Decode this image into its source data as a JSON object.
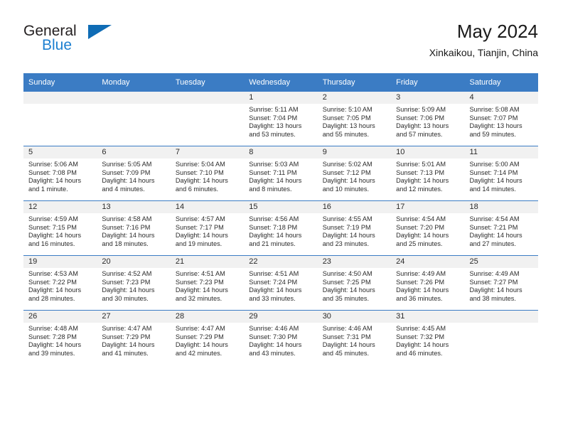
{
  "logo": {
    "word_one": "General",
    "word_two": "Blue",
    "triangle_icon": "triangle-icon",
    "colors": {
      "text": "#231f20",
      "blue": "#1c7fd0",
      "triangle": "#0f6cb5"
    }
  },
  "header": {
    "title": "May 2024",
    "subtitle": "Xinkaikou, Tianjin, China"
  },
  "theme": {
    "header_blue": "#3b7cc4",
    "band_gray": "#f1f1f1",
    "text": "#2b2b2b"
  },
  "weekday_headers": [
    "Sunday",
    "Monday",
    "Tuesday",
    "Wednesday",
    "Thursday",
    "Friday",
    "Saturday"
  ],
  "weeks": [
    [
      {
        "day": "",
        "sunrise": "",
        "sunset": "",
        "daylight_line1": "",
        "daylight_line2": ""
      },
      {
        "day": "",
        "sunrise": "",
        "sunset": "",
        "daylight_line1": "",
        "daylight_line2": ""
      },
      {
        "day": "",
        "sunrise": "",
        "sunset": "",
        "daylight_line1": "",
        "daylight_line2": ""
      },
      {
        "day": "1",
        "sunrise": "Sunrise: 5:11 AM",
        "sunset": "Sunset: 7:04 PM",
        "daylight_line1": "Daylight: 13 hours",
        "daylight_line2": "and 53 minutes."
      },
      {
        "day": "2",
        "sunrise": "Sunrise: 5:10 AM",
        "sunset": "Sunset: 7:05 PM",
        "daylight_line1": "Daylight: 13 hours",
        "daylight_line2": "and 55 minutes."
      },
      {
        "day": "3",
        "sunrise": "Sunrise: 5:09 AM",
        "sunset": "Sunset: 7:06 PM",
        "daylight_line1": "Daylight: 13 hours",
        "daylight_line2": "and 57 minutes."
      },
      {
        "day": "4",
        "sunrise": "Sunrise: 5:08 AM",
        "sunset": "Sunset: 7:07 PM",
        "daylight_line1": "Daylight: 13 hours",
        "daylight_line2": "and 59 minutes."
      }
    ],
    [
      {
        "day": "5",
        "sunrise": "Sunrise: 5:06 AM",
        "sunset": "Sunset: 7:08 PM",
        "daylight_line1": "Daylight: 14 hours",
        "daylight_line2": "and 1 minute."
      },
      {
        "day": "6",
        "sunrise": "Sunrise: 5:05 AM",
        "sunset": "Sunset: 7:09 PM",
        "daylight_line1": "Daylight: 14 hours",
        "daylight_line2": "and 4 minutes."
      },
      {
        "day": "7",
        "sunrise": "Sunrise: 5:04 AM",
        "sunset": "Sunset: 7:10 PM",
        "daylight_line1": "Daylight: 14 hours",
        "daylight_line2": "and 6 minutes."
      },
      {
        "day": "8",
        "sunrise": "Sunrise: 5:03 AM",
        "sunset": "Sunset: 7:11 PM",
        "daylight_line1": "Daylight: 14 hours",
        "daylight_line2": "and 8 minutes."
      },
      {
        "day": "9",
        "sunrise": "Sunrise: 5:02 AM",
        "sunset": "Sunset: 7:12 PM",
        "daylight_line1": "Daylight: 14 hours",
        "daylight_line2": "and 10 minutes."
      },
      {
        "day": "10",
        "sunrise": "Sunrise: 5:01 AM",
        "sunset": "Sunset: 7:13 PM",
        "daylight_line1": "Daylight: 14 hours",
        "daylight_line2": "and 12 minutes."
      },
      {
        "day": "11",
        "sunrise": "Sunrise: 5:00 AM",
        "sunset": "Sunset: 7:14 PM",
        "daylight_line1": "Daylight: 14 hours",
        "daylight_line2": "and 14 minutes."
      }
    ],
    [
      {
        "day": "12",
        "sunrise": "Sunrise: 4:59 AM",
        "sunset": "Sunset: 7:15 PM",
        "daylight_line1": "Daylight: 14 hours",
        "daylight_line2": "and 16 minutes."
      },
      {
        "day": "13",
        "sunrise": "Sunrise: 4:58 AM",
        "sunset": "Sunset: 7:16 PM",
        "daylight_line1": "Daylight: 14 hours",
        "daylight_line2": "and 18 minutes."
      },
      {
        "day": "14",
        "sunrise": "Sunrise: 4:57 AM",
        "sunset": "Sunset: 7:17 PM",
        "daylight_line1": "Daylight: 14 hours",
        "daylight_line2": "and 19 minutes."
      },
      {
        "day": "15",
        "sunrise": "Sunrise: 4:56 AM",
        "sunset": "Sunset: 7:18 PM",
        "daylight_line1": "Daylight: 14 hours",
        "daylight_line2": "and 21 minutes."
      },
      {
        "day": "16",
        "sunrise": "Sunrise: 4:55 AM",
        "sunset": "Sunset: 7:19 PM",
        "daylight_line1": "Daylight: 14 hours",
        "daylight_line2": "and 23 minutes."
      },
      {
        "day": "17",
        "sunrise": "Sunrise: 4:54 AM",
        "sunset": "Sunset: 7:20 PM",
        "daylight_line1": "Daylight: 14 hours",
        "daylight_line2": "and 25 minutes."
      },
      {
        "day": "18",
        "sunrise": "Sunrise: 4:54 AM",
        "sunset": "Sunset: 7:21 PM",
        "daylight_line1": "Daylight: 14 hours",
        "daylight_line2": "and 27 minutes."
      }
    ],
    [
      {
        "day": "19",
        "sunrise": "Sunrise: 4:53 AM",
        "sunset": "Sunset: 7:22 PM",
        "daylight_line1": "Daylight: 14 hours",
        "daylight_line2": "and 28 minutes."
      },
      {
        "day": "20",
        "sunrise": "Sunrise: 4:52 AM",
        "sunset": "Sunset: 7:23 PM",
        "daylight_line1": "Daylight: 14 hours",
        "daylight_line2": "and 30 minutes."
      },
      {
        "day": "21",
        "sunrise": "Sunrise: 4:51 AM",
        "sunset": "Sunset: 7:23 PM",
        "daylight_line1": "Daylight: 14 hours",
        "daylight_line2": "and 32 minutes."
      },
      {
        "day": "22",
        "sunrise": "Sunrise: 4:51 AM",
        "sunset": "Sunset: 7:24 PM",
        "daylight_line1": "Daylight: 14 hours",
        "daylight_line2": "and 33 minutes."
      },
      {
        "day": "23",
        "sunrise": "Sunrise: 4:50 AM",
        "sunset": "Sunset: 7:25 PM",
        "daylight_line1": "Daylight: 14 hours",
        "daylight_line2": "and 35 minutes."
      },
      {
        "day": "24",
        "sunrise": "Sunrise: 4:49 AM",
        "sunset": "Sunset: 7:26 PM",
        "daylight_line1": "Daylight: 14 hours",
        "daylight_line2": "and 36 minutes."
      },
      {
        "day": "25",
        "sunrise": "Sunrise: 4:49 AM",
        "sunset": "Sunset: 7:27 PM",
        "daylight_line1": "Daylight: 14 hours",
        "daylight_line2": "and 38 minutes."
      }
    ],
    [
      {
        "day": "26",
        "sunrise": "Sunrise: 4:48 AM",
        "sunset": "Sunset: 7:28 PM",
        "daylight_line1": "Daylight: 14 hours",
        "daylight_line2": "and 39 minutes."
      },
      {
        "day": "27",
        "sunrise": "Sunrise: 4:47 AM",
        "sunset": "Sunset: 7:29 PM",
        "daylight_line1": "Daylight: 14 hours",
        "daylight_line2": "and 41 minutes."
      },
      {
        "day": "28",
        "sunrise": "Sunrise: 4:47 AM",
        "sunset": "Sunset: 7:29 PM",
        "daylight_line1": "Daylight: 14 hours",
        "daylight_line2": "and 42 minutes."
      },
      {
        "day": "29",
        "sunrise": "Sunrise: 4:46 AM",
        "sunset": "Sunset: 7:30 PM",
        "daylight_line1": "Daylight: 14 hours",
        "daylight_line2": "and 43 minutes."
      },
      {
        "day": "30",
        "sunrise": "Sunrise: 4:46 AM",
        "sunset": "Sunset: 7:31 PM",
        "daylight_line1": "Daylight: 14 hours",
        "daylight_line2": "and 45 minutes."
      },
      {
        "day": "31",
        "sunrise": "Sunrise: 4:45 AM",
        "sunset": "Sunset: 7:32 PM",
        "daylight_line1": "Daylight: 14 hours",
        "daylight_line2": "and 46 minutes."
      },
      {
        "day": "",
        "sunrise": "",
        "sunset": "",
        "daylight_line1": "",
        "daylight_line2": ""
      }
    ]
  ]
}
